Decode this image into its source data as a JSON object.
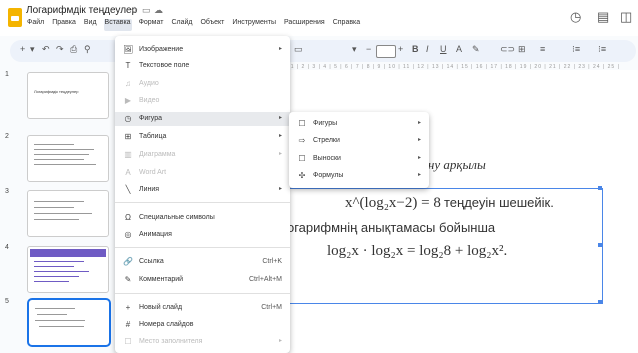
{
  "app": {
    "title": "Логарифмдік теңдеулер",
    "menu": [
      "Файл",
      "Правка",
      "Вид",
      "Вставка",
      "Формат",
      "Слайд",
      "Объект",
      "Инструменты",
      "Расширения",
      "Справка"
    ],
    "active_menu": "Вставка"
  },
  "toolbar": {
    "left": [
      "+",
      "▾",
      "↶",
      "↷",
      "⎙",
      "⚲",
      "▭",
      "↖",
      "▾",
      "▭"
    ],
    "right": [
      "▾",
      "−",
      "+",
      "B",
      "I",
      "U",
      "A",
      "✎",
      "⊂⊃",
      "⊞",
      "≡",
      "⁝≡",
      "⁝≡"
    ]
  },
  "ruler_text": "| 1 | 2 | 3 | 4 | 5 | 6 | 7 | 8 | 9 | 10 | 11 | 12 | 13 | 14 | 15 | 16 | 17 | 18 | 19 | 20 | 21 | 22 | 23 | 24 | 25 |",
  "slides": [
    {
      "num": "1",
      "title": "Логарифмдік теңдеулер"
    },
    {
      "num": "2"
    },
    {
      "num": "3"
    },
    {
      "num": "4"
    },
    {
      "num": "5"
    }
  ],
  "slide": {
    "line1": "олдану арқылы",
    "eq1": "x^(log₂x−2) = 8",
    "line2": "теңдеуін шешейік.",
    "line3": "огарифмнің анықтамасы бойынша",
    "eq2": "log₂x · log₂x = log₂8 + log₂x²."
  },
  "insert_menu": {
    "items": [
      {
        "icon": "🖼",
        "label": "Изображение",
        "arrow": "▸",
        "disabled": false
      },
      {
        "icon": "T",
        "label": "Текстовое поле",
        "disabled": false
      },
      {
        "icon": "♫",
        "label": "Аудио",
        "disabled": true
      },
      {
        "icon": "▶",
        "label": "Видео",
        "disabled": true
      },
      {
        "icon": "◷",
        "label": "Фигура",
        "arrow": "▸",
        "highlight": true
      },
      {
        "icon": "⊞",
        "label": "Таблица",
        "arrow": "▸"
      },
      {
        "icon": "▥",
        "label": "Диаграмма",
        "arrow": "▸",
        "disabled": true
      },
      {
        "icon": "A",
        "label": "Word Art",
        "disabled": true
      },
      {
        "icon": "╲",
        "label": "Линия",
        "arrow": "▸"
      },
      {
        "icon": "Ω",
        "label": "Специальные символы"
      },
      {
        "icon": "◎",
        "label": "Анимация"
      },
      {
        "icon": "🔗",
        "label": "Ссылка",
        "shortcut": "Ctrl+K"
      },
      {
        "icon": "✎",
        "label": "Комментарий",
        "shortcut": "Ctrl+Alt+M"
      },
      {
        "icon": "+",
        "label": "Новый слайд",
        "shortcut": "Ctrl+M"
      },
      {
        "icon": "#",
        "label": "Номера слайдов"
      },
      {
        "icon": "☐",
        "label": "Место заполнителя",
        "arrow": "▸",
        "disabled": true
      }
    ]
  },
  "shape_submenu": {
    "items": [
      {
        "icon": "☐",
        "label": "Фигуры"
      },
      {
        "icon": "⇨",
        "label": "Стрелки"
      },
      {
        "icon": "☐",
        "label": "Выноски"
      },
      {
        "icon": "✣",
        "label": "Формулы"
      }
    ]
  }
}
